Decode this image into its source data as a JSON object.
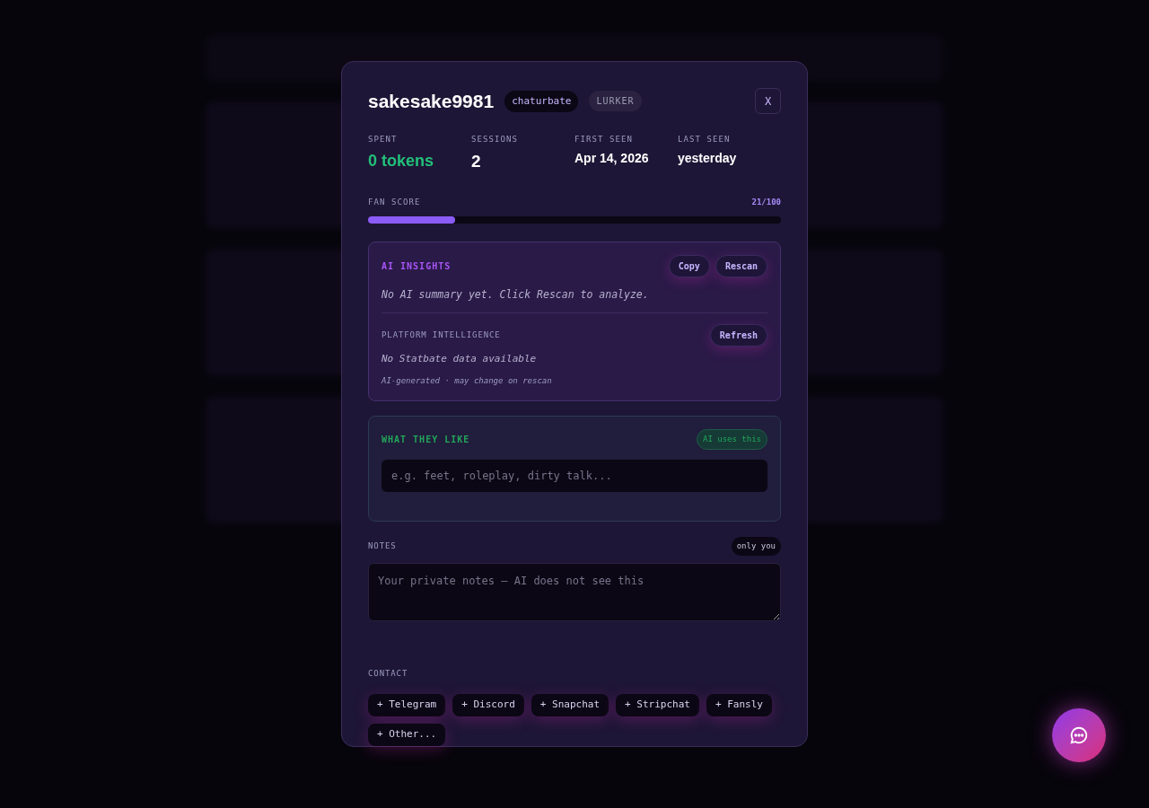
{
  "profile": {
    "username": "sakesake9981",
    "platform": "chaturbate",
    "tier": "LURKER",
    "close": "X"
  },
  "stats": [
    {
      "label": "SPENT",
      "value": "0 tokens",
      "kind": "money"
    },
    {
      "label": "SESSIONS",
      "value": "2",
      "kind": "big"
    },
    {
      "label": "FIRST SEEN",
      "value": "Apr 14, 2026",
      "kind": "date"
    },
    {
      "label": "LAST SEEN",
      "value": "yesterday",
      "kind": "date"
    }
  ],
  "fan_score": {
    "label": "FAN SCORE",
    "reading": "21/100",
    "level": 0.21
  },
  "ai_insights": {
    "title": "AI INSIGHTS",
    "buttons": [
      "Copy",
      "Rescan"
    ],
    "summary": "No AI summary yet. Click Rescan to analyze.",
    "platform_title": "PLATFORM INTELLIGENCE",
    "platform_button": "Refresh",
    "platform_text": "No Statbate data available",
    "footnote": "AI-generated · may change on rescan"
  },
  "likes": {
    "title": "WHAT THEY LIKE",
    "badge": "AI uses this",
    "placeholder": "e.g. feet, roleplay, dirty talk..."
  },
  "notes": {
    "title": "NOTES",
    "badge": "only you",
    "placeholder": "Your private notes — AI does not see this"
  },
  "contact": {
    "title": "CONTACT",
    "buttons": [
      "+ Telegram",
      "+ Discord",
      "+ Snapchat",
      "+ Stripchat",
      "+ Fansly",
      "+ Other..."
    ]
  }
}
